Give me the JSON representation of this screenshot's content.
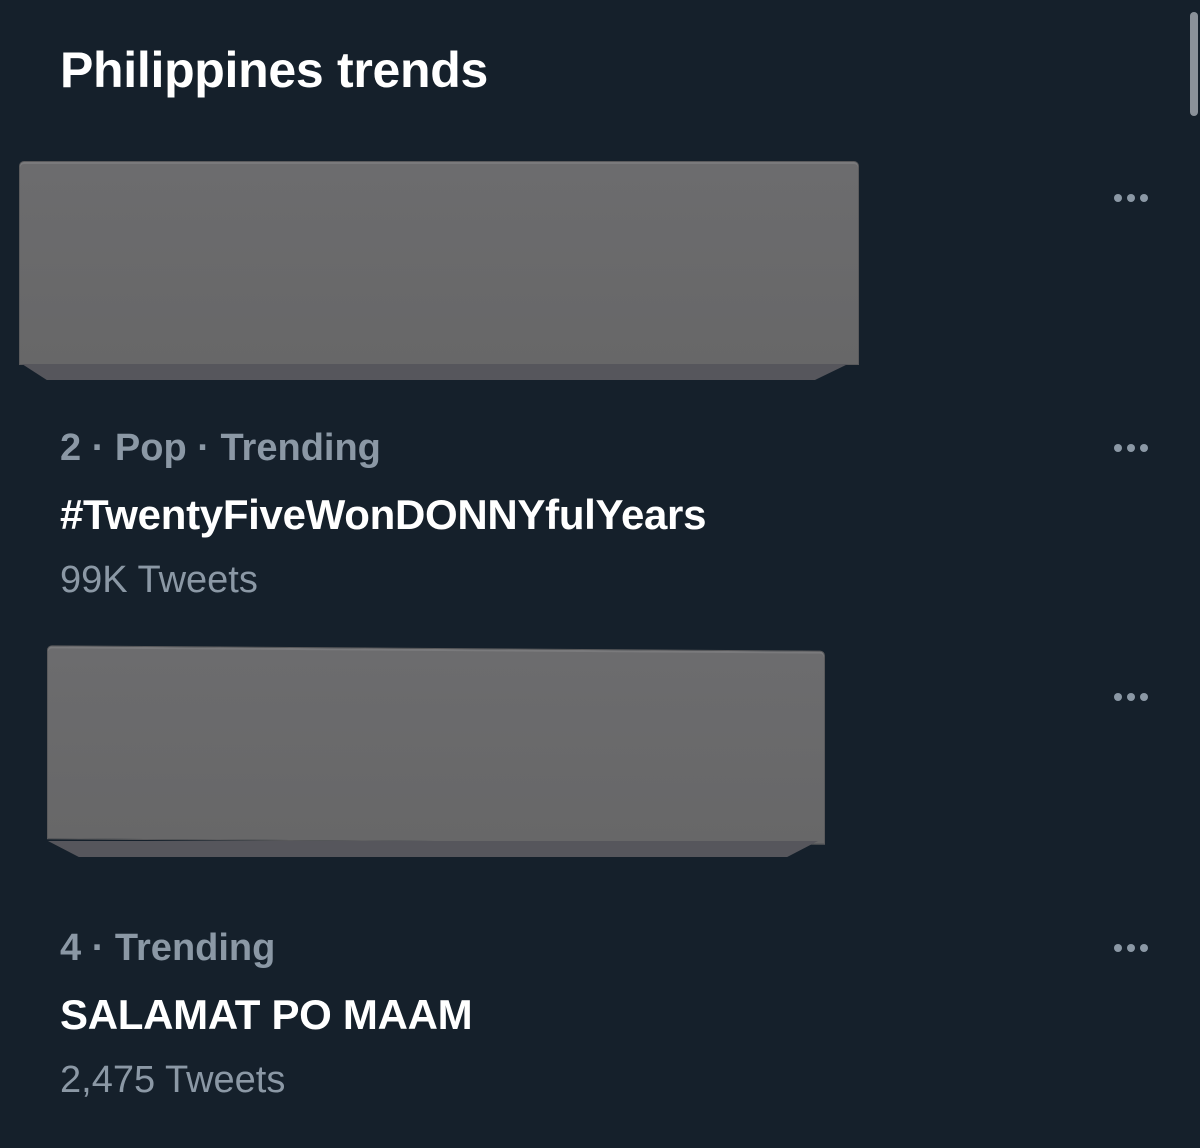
{
  "header": {
    "title": "Philippines trends"
  },
  "trends": [
    {
      "redacted": true
    },
    {
      "meta": "2 · Pop · Trending",
      "name": "#TwentyFiveWonDONNYfulYears",
      "count": "99K Tweets"
    },
    {
      "redacted": true
    },
    {
      "meta": "4 · Trending",
      "name": "SALAMAT PO MAAM",
      "count": "2,475 Tweets"
    }
  ],
  "icons": {
    "more": "more-horizontal-icon"
  },
  "colors": {
    "background": "#15202b",
    "primary_text": "#ffffff",
    "secondary_text": "#8b98a5",
    "redaction": "#6a6a6c"
  }
}
